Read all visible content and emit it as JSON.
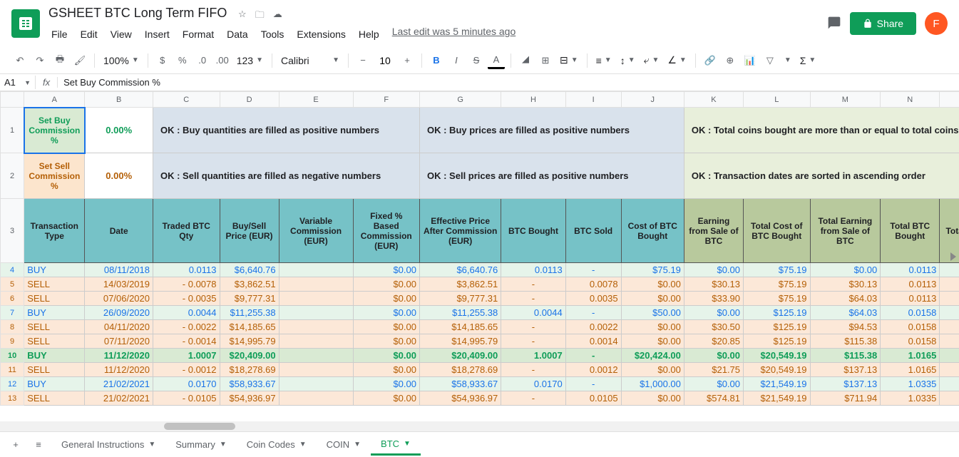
{
  "doc_title": "GSHEET BTC Long Term FIFO",
  "menus": [
    "File",
    "Edit",
    "View",
    "Insert",
    "Format",
    "Data",
    "Tools",
    "Extensions",
    "Help"
  ],
  "last_edit": "Last edit was 5 minutes ago",
  "share_label": "Share",
  "avatar_letter": "F",
  "toolbar": {
    "zoom": "100%",
    "font": "Calibri",
    "size": "10",
    "more_formats": "123"
  },
  "name_box": "A1",
  "formula": "Set Buy Commission %",
  "col_headers": [
    "A",
    "B",
    "C",
    "D",
    "E",
    "F",
    "G",
    "H",
    "I",
    "J",
    "K",
    "L",
    "M",
    "N",
    ""
  ],
  "row1": {
    "A": "Set Buy Commission %",
    "B": "0.00%",
    "msg1": "OK : Buy quantities are filled as positive numbers",
    "msg2": "OK : Buy prices are filled as positive numbers",
    "msg3": "OK : Total coins bought are more than or equal to total coins"
  },
  "row2": {
    "A": "Set Sell Commission %",
    "B": "0.00%",
    "msg1": "OK : Sell quantities are filled as negative numbers",
    "msg2": "OK : Sell prices are filled as positive numbers",
    "msg3": "OK : Transaction dates are sorted in ascending order"
  },
  "headers": [
    "Transaction Type",
    "Date",
    "Traded BTC Qty",
    "Buy/Sell Price (EUR)",
    "Variable Commission (EUR)",
    "Fixed % Based Commission (EUR)",
    "Effective Price After Commission (EUR)",
    "BTC Bought",
    "BTC Sold",
    "Cost of BTC Bought",
    "Earning from Sale of BTC",
    "Total Cost of BTC Bought",
    "Total Earning from Sale of BTC",
    "Total BTC Bought",
    "Tota"
  ],
  "rows": [
    {
      "n": 4,
      "cls": "row-buy",
      "c": [
        "BUY",
        "08/11/2018",
        "0.0113",
        "$6,640.76",
        "",
        "$0.00",
        "$6,640.76",
        "0.0113",
        "-",
        "$75.19",
        "$0.00",
        "$75.19",
        "$0.00",
        "0.0113",
        ""
      ]
    },
    {
      "n": 5,
      "cls": "row-sell",
      "c": [
        "SELL",
        "14/03/2019",
        "-       0.0078",
        "$3,862.51",
        "",
        "$0.00",
        "$3,862.51",
        "-",
        "0.0078",
        "$0.00",
        "$30.13",
        "$75.19",
        "$30.13",
        "0.0113",
        ""
      ]
    },
    {
      "n": 6,
      "cls": "row-sell",
      "c": [
        "SELL",
        "07/06/2020",
        "-       0.0035",
        "$9,777.31",
        "",
        "$0.00",
        "$9,777.31",
        "-",
        "0.0035",
        "$0.00",
        "$33.90",
        "$75.19",
        "$64.03",
        "0.0113",
        ""
      ]
    },
    {
      "n": 7,
      "cls": "row-buy",
      "c": [
        "BUY",
        "26/09/2020",
        "0.0044",
        "$11,255.38",
        "",
        "$0.00",
        "$11,255.38",
        "0.0044",
        "-",
        "$50.00",
        "$0.00",
        "$125.19",
        "$64.03",
        "0.0158",
        ""
      ]
    },
    {
      "n": 8,
      "cls": "row-sell",
      "c": [
        "SELL",
        "04/11/2020",
        "-       0.0022",
        "$14,185.65",
        "",
        "$0.00",
        "$14,185.65",
        "-",
        "0.0022",
        "$0.00",
        "$30.50",
        "$125.19",
        "$94.53",
        "0.0158",
        ""
      ]
    },
    {
      "n": 9,
      "cls": "row-sell",
      "c": [
        "SELL",
        "07/11/2020",
        "-       0.0014",
        "$14,995.79",
        "",
        "$0.00",
        "$14,995.79",
        "-",
        "0.0014",
        "$0.00",
        "$20.85",
        "$125.19",
        "$115.38",
        "0.0158",
        ""
      ]
    },
    {
      "n": 10,
      "cls": "row-buy-green",
      "c": [
        "BUY",
        "11/12/2020",
        "1.0007",
        "$20,409.00",
        "",
        "$0.00",
        "$20,409.00",
        "1.0007",
        "-",
        "$20,424.00",
        "$0.00",
        "$20,549.19",
        "$115.38",
        "1.0165",
        ""
      ]
    },
    {
      "n": 11,
      "cls": "row-sell",
      "c": [
        "SELL",
        "11/12/2020",
        "-       0.0012",
        "$18,278.69",
        "",
        "$0.00",
        "$18,278.69",
        "-",
        "0.0012",
        "$0.00",
        "$21.75",
        "$20,549.19",
        "$137.13",
        "1.0165",
        ""
      ]
    },
    {
      "n": 12,
      "cls": "row-buy",
      "c": [
        "BUY",
        "21/02/2021",
        "0.0170",
        "$58,933.67",
        "",
        "$0.00",
        "$58,933.67",
        "0.0170",
        "-",
        "$1,000.00",
        "$0.00",
        "$21,549.19",
        "$137.13",
        "1.0335",
        ""
      ]
    },
    {
      "n": 13,
      "cls": "row-sell",
      "c": [
        "SELL",
        "21/02/2021",
        "-       0.0105",
        "$54,936.97",
        "",
        "$0.00",
        "$54,936.97",
        "-",
        "0.0105",
        "$0.00",
        "$574.81",
        "$21,549.19",
        "$711.94",
        "1.0335",
        ""
      ]
    }
  ],
  "tabs": [
    {
      "name": "General Instructions",
      "active": false
    },
    {
      "name": "Summary",
      "active": false
    },
    {
      "name": "Coin Codes",
      "active": false
    },
    {
      "name": "COIN",
      "active": false
    },
    {
      "name": "BTC",
      "active": true
    }
  ]
}
